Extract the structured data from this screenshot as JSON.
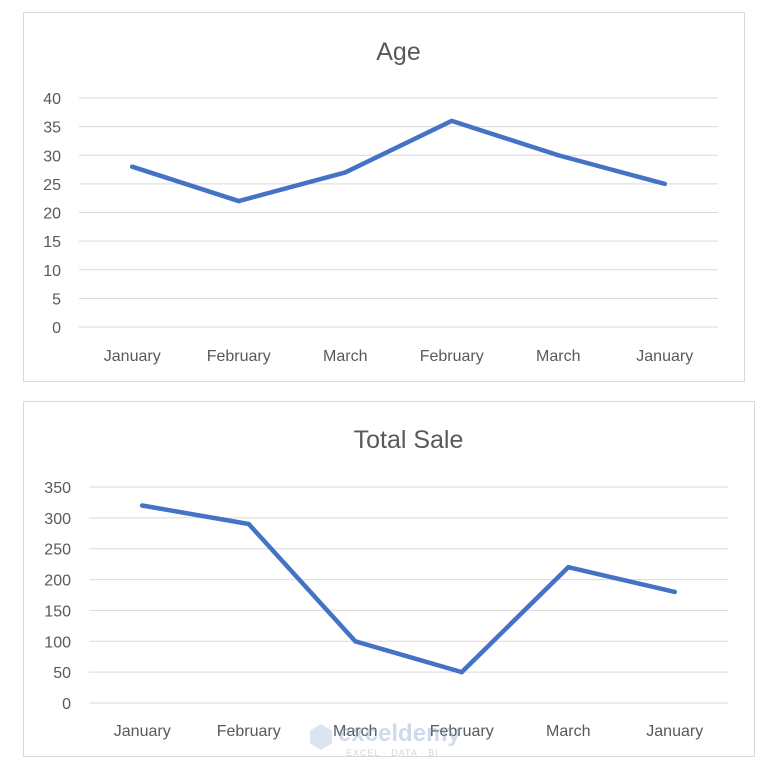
{
  "chart_data": [
    {
      "type": "line",
      "title": "Age",
      "categories": [
        "January",
        "February",
        "March",
        "February",
        "March",
        "January"
      ],
      "series": [
        {
          "name": "Age",
          "values": [
            28,
            22,
            27,
            36,
            30,
            25
          ],
          "color": "#4472c4"
        }
      ],
      "yticks": [
        "0",
        "5",
        "10",
        "15",
        "20",
        "25",
        "30",
        "35",
        "40"
      ],
      "ylim": [
        0,
        40
      ],
      "xlabel": "",
      "ylabel": "",
      "grid": true,
      "legend": "none"
    },
    {
      "type": "line",
      "title": "Total Sale",
      "categories": [
        "January",
        "February",
        "March",
        "February",
        "March",
        "January"
      ],
      "series": [
        {
          "name": "Total Sale",
          "values": [
            320,
            290,
            100,
            50,
            220,
            180
          ],
          "color": "#4472c4"
        }
      ],
      "yticks": [
        "0",
        "50",
        "100",
        "150",
        "200",
        "250",
        "300",
        "350"
      ],
      "ylim": [
        0,
        350
      ],
      "xlabel": "",
      "ylabel": "",
      "grid": true,
      "legend": "none"
    }
  ],
  "watermark": {
    "name": "exceldemy",
    "tagline": "EXCEL · DATA · BI"
  }
}
